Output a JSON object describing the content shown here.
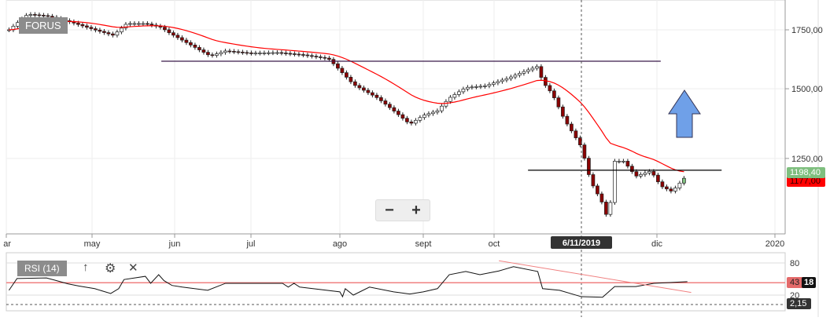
{
  "symbol": "FORUS",
  "crosshair_date": "6/11/2019",
  "zoom": {
    "minus": "−",
    "plus": "+"
  },
  "indicator": {
    "label": "RSI (14)",
    "up_icon": "arrow-up-icon",
    "settings_icon": "gear-icon",
    "close_icon": "close-icon",
    "ticks": [
      "80",
      "20"
    ],
    "value_label": "43",
    "value_label_suffix": "18",
    "second_label": "2,15"
  },
  "price_labels": {
    "last": "1198,40",
    "prev": "1177,00"
  },
  "colors": {
    "up": "#ffffff",
    "down": "#8b0000",
    "ma": "#ff0000",
    "last_tag": "#7fbf7f",
    "prev_tag": "#ff0000",
    "rsi_ref": "#f08080",
    "resistance": "#3a1a4a",
    "arrow": "#6fa0e8"
  },
  "chart_data": {
    "type": "candlestick",
    "y_scale": "log",
    "y_ticks": [
      "1750,00",
      "1500,00",
      "1250,00"
    ],
    "y_tick_values": [
      1750,
      1500,
      1250
    ],
    "x_ticks": [
      "ar",
      "may",
      "jun",
      "jul",
      "ago",
      "sept",
      "oct",
      "dic",
      "2020"
    ],
    "closes": [
      [
        "2019-03-31",
        1750
      ],
      [
        "2019-04-07",
        1823
      ],
      [
        "2019-04-14",
        1815
      ],
      [
        "2019-04-23",
        1786
      ],
      [
        "2019-05-02",
        1750
      ],
      [
        "2019-05-09",
        1725
      ],
      [
        "2019-05-14",
        1779
      ],
      [
        "2019-05-21",
        1779
      ],
      [
        "2019-05-27",
        1761
      ],
      [
        "2019-05-30",
        1736
      ],
      [
        "2019-06-06",
        1690
      ],
      [
        "2019-06-15",
        1634
      ],
      [
        "2019-06-21",
        1656
      ],
      [
        "2019-07-01",
        1646
      ],
      [
        "2019-07-10",
        1649
      ],
      [
        "2019-07-19",
        1639
      ],
      [
        "2019-07-28",
        1623
      ],
      [
        "2019-08-01",
        1574
      ],
      [
        "2019-08-06",
        1517
      ],
      [
        "2019-08-15",
        1464
      ],
      [
        "2019-08-21",
        1416
      ],
      [
        "2019-08-27",
        1367
      ],
      [
        "2019-09-01",
        1399
      ],
      [
        "2019-09-07",
        1416
      ],
      [
        "2019-09-12",
        1464
      ],
      [
        "2019-09-19",
        1505
      ],
      [
        "2019-09-27",
        1511
      ],
      [
        "2019-10-07",
        1543
      ],
      [
        "2019-10-13",
        1568
      ],
      [
        "2019-10-19",
        1591
      ],
      [
        "2019-10-21",
        1527
      ],
      [
        "2019-10-25",
        1480
      ],
      [
        "2019-10-30",
        1383
      ],
      [
        "2019-11-06",
        1288
      ],
      [
        "2019-11-09",
        1178
      ],
      [
        "2019-11-13",
        1111
      ],
      [
        "2019-11-15",
        1058
      ],
      [
        "2019-11-17",
        1241
      ],
      [
        "2019-11-20",
        1241
      ],
      [
        "2019-11-24",
        1193
      ],
      [
        "2019-11-29",
        1210
      ],
      [
        "2019-12-02",
        1163
      ],
      [
        "2019-12-05",
        1146
      ],
      [
        "2019-12-09",
        1198.4
      ]
    ],
    "horizontal_lines": [
      {
        "price": 1612,
        "from": "2019-05-27",
        "to": "2019-12-02"
      },
      {
        "price": 1212,
        "from": "2019-10-15",
        "to": "2019-12-18"
      }
    ],
    "rsi": {
      "ylim": [
        0,
        100
      ],
      "reference": 43,
      "values": [
        [
          "2019-03-31",
          29
        ],
        [
          "2019-04-03",
          51
        ],
        [
          "2019-04-14",
          52
        ],
        [
          "2019-04-17",
          48
        ],
        [
          "2019-04-22",
          41
        ],
        [
          "2019-04-26",
          37
        ],
        [
          "2019-05-02",
          32
        ],
        [
          "2019-05-08",
          23
        ],
        [
          "2019-05-11",
          32
        ],
        [
          "2019-05-13",
          49
        ],
        [
          "2019-05-21",
          55
        ],
        [
          "2019-05-23",
          42
        ],
        [
          "2019-05-26",
          58
        ],
        [
          "2019-05-28",
          47
        ],
        [
          "2019-05-31",
          38
        ],
        [
          "2019-06-04",
          35
        ],
        [
          "2019-06-14",
          29
        ],
        [
          "2019-06-21",
          42
        ],
        [
          "2019-07-12",
          42
        ],
        [
          "2019-07-14",
          35
        ],
        [
          "2019-07-16",
          42
        ],
        [
          "2019-07-18",
          35
        ],
        [
          "2019-08-01",
          26
        ],
        [
          "2019-08-02",
          17
        ],
        [
          "2019-08-03",
          32
        ],
        [
          "2019-08-06",
          20
        ],
        [
          "2019-08-12",
          35
        ],
        [
          "2019-08-21",
          26
        ],
        [
          "2019-08-27",
          22
        ],
        [
          "2019-09-01",
          26
        ],
        [
          "2019-09-07",
          32
        ],
        [
          "2019-09-12",
          58
        ],
        [
          "2019-09-19",
          64
        ],
        [
          "2019-09-25",
          58
        ],
        [
          "2019-10-03",
          65
        ],
        [
          "2019-10-09",
          73
        ],
        [
          "2019-10-19",
          64
        ],
        [
          "2019-10-21",
          32
        ],
        [
          "2019-10-28",
          29
        ],
        [
          "2019-11-06",
          17
        ],
        [
          "2019-11-13",
          16
        ],
        [
          "2019-11-17",
          36
        ],
        [
          "2019-11-24",
          36
        ],
        [
          "2019-11-30",
          42
        ],
        [
          "2019-12-09",
          45
        ]
      ],
      "trendline": [
        [
          "2019-10-03",
          84
        ],
        [
          "2019-12-10",
          25
        ]
      ]
    }
  }
}
